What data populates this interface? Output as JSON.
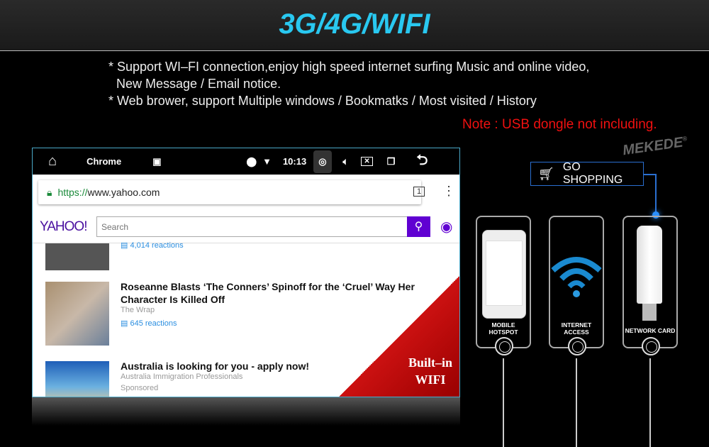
{
  "header": {
    "title": "3G/4G/WIFI"
  },
  "features": [
    "* Support WI–FI connection,enjoy high speed internet surfing Music and online video,",
    "New Message / Email notice.",
    "* Web brower, support Multiple windows / Bookmatks / Most visited / History"
  ],
  "note": "Note : USB dongle not including.",
  "brand": "MEKEDE",
  "brand_mark": "®",
  "status_bar": {
    "app": "Chrome",
    "time": "10:13"
  },
  "browser": {
    "url_scheme": "https://",
    "url_host": "www.yahoo.com",
    "tab_count": "1"
  },
  "yahoo": {
    "logo": "YAHOO!",
    "search_placeholder": "Search",
    "accent": "#6001d2"
  },
  "articles": [
    {
      "reactions": "4,014 reactions"
    },
    {
      "title": "Roseanne Blasts ‘The Conners’ Spinoff for the ‘Cruel’ Way Her Character Is Killed Off",
      "source": "The Wrap",
      "reactions": "645 reactions"
    },
    {
      "title": "Australia is looking for you - apply now!",
      "source": "Australia Immigration Professionals",
      "sponsored": "Sponsored"
    }
  ],
  "badge": {
    "line1": "Built–in",
    "line2": "WIFI"
  },
  "go_shopping": "GO SHOPPING",
  "cards": [
    {
      "label": "MOBILE HOTSPOT"
    },
    {
      "label": "INTERNET ACCESS"
    },
    {
      "label": "NETWORK  CARD"
    }
  ],
  "colors": {
    "title": "#29c8f0",
    "note": "#f01010",
    "badge": "#c11111"
  }
}
